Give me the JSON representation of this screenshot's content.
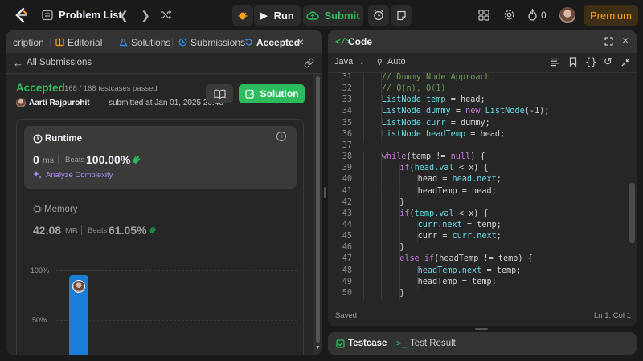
{
  "topbar": {
    "problem_list": "Problem List",
    "run": "Run",
    "submit": "Submit",
    "streak": "0",
    "premium": "Premium"
  },
  "left_tabs": {
    "description": "cription",
    "editorial": "Editorial",
    "solutions": "Solutions",
    "submissions": "Submissions",
    "accepted": "Accepted"
  },
  "submission": {
    "back_label": "All Submissions",
    "status": "Accepted",
    "testcases": "168 / 168 testcases passed",
    "author": "Aarti Rajpurohit",
    "submitted_at": "submitted at Jan 01, 2025 20:48",
    "solution_button": "Solution",
    "runtime": {
      "title": "Runtime",
      "value": "0",
      "unit": "ms",
      "beats_label": "Beats",
      "beats_value": "100.00%",
      "analyze": "Analyze Complexity"
    },
    "memory": {
      "title": "Memory",
      "value": "42.08",
      "unit": "MB",
      "beats_label": "Beats",
      "beats_value": "61.05%"
    },
    "chart": {
      "y_ticks": [
        "100%",
        "50%"
      ],
      "bar_fraction": 0.95
    }
  },
  "code_panel": {
    "title": "Code",
    "language": "Java",
    "mode": "Auto",
    "status": "Saved",
    "cursor": "Ln 1, Col 1",
    "lines": [
      {
        "n": "31",
        "indent": 2,
        "parts": [
          [
            "cm",
            "// Dummy Node Approach"
          ]
        ]
      },
      {
        "n": "32",
        "indent": 2,
        "parts": [
          [
            "cm",
            "// O(n), O(1)"
          ]
        ]
      },
      {
        "n": "33",
        "indent": 2,
        "parts": [
          [
            "ty",
            "ListNode"
          ],
          [
            "pl",
            " "
          ],
          [
            "ty",
            "temp"
          ],
          [
            "pl",
            " = head;"
          ]
        ]
      },
      {
        "n": "34",
        "indent": 2,
        "parts": [
          [
            "ty",
            "ListNode"
          ],
          [
            "pl",
            " "
          ],
          [
            "ty",
            "dummy"
          ],
          [
            "pl",
            " = "
          ],
          [
            "kw",
            "new"
          ],
          [
            "pl",
            " "
          ],
          [
            "ty",
            "ListNode"
          ],
          [
            "pl",
            "(-1);"
          ]
        ]
      },
      {
        "n": "35",
        "indent": 2,
        "parts": [
          [
            "ty",
            "ListNode"
          ],
          [
            "pl",
            " "
          ],
          [
            "ty",
            "curr"
          ],
          [
            "pl",
            " = dummy;"
          ]
        ]
      },
      {
        "n": "36",
        "indent": 2,
        "parts": [
          [
            "ty",
            "ListNode"
          ],
          [
            "pl",
            " "
          ],
          [
            "ty",
            "headTemp"
          ],
          [
            "pl",
            " = head;"
          ]
        ]
      },
      {
        "n": "37",
        "indent": 0,
        "parts": []
      },
      {
        "n": "38",
        "indent": 2,
        "parts": [
          [
            "kw",
            "while"
          ],
          [
            "pl",
            "(temp != "
          ],
          [
            "kw",
            "null"
          ],
          [
            "pl",
            ") {"
          ]
        ]
      },
      {
        "n": "39",
        "indent": 3,
        "parts": [
          [
            "kw",
            "if"
          ],
          [
            "pl",
            "("
          ],
          [
            "ty",
            "head.val"
          ],
          [
            "pl",
            " < x) {"
          ]
        ]
      },
      {
        "n": "40",
        "indent": 4,
        "parts": [
          [
            "pl",
            "head = "
          ],
          [
            "ty",
            "head.next"
          ],
          [
            "pl",
            ";"
          ]
        ]
      },
      {
        "n": "41",
        "indent": 4,
        "parts": [
          [
            "pl",
            "headTemp = head;"
          ]
        ]
      },
      {
        "n": "42",
        "indent": 3,
        "parts": [
          [
            "pl",
            "}"
          ]
        ]
      },
      {
        "n": "43",
        "indent": 3,
        "parts": [
          [
            "kw",
            "if"
          ],
          [
            "pl",
            "("
          ],
          [
            "ty",
            "temp.val"
          ],
          [
            "pl",
            " < x) {"
          ]
        ]
      },
      {
        "n": "44",
        "indent": 4,
        "parts": [
          [
            "ty",
            "curr.next"
          ],
          [
            "pl",
            " = temp;"
          ]
        ]
      },
      {
        "n": "45",
        "indent": 4,
        "parts": [
          [
            "pl",
            "curr = "
          ],
          [
            "ty",
            "curr.next"
          ],
          [
            "pl",
            ";"
          ]
        ]
      },
      {
        "n": "46",
        "indent": 3,
        "parts": [
          [
            "pl",
            "}"
          ]
        ]
      },
      {
        "n": "47",
        "indent": 3,
        "parts": [
          [
            "kw",
            "else if"
          ],
          [
            "pl",
            "(headTemp != temp) {"
          ]
        ]
      },
      {
        "n": "48",
        "indent": 4,
        "parts": [
          [
            "ty",
            "headTemp.next"
          ],
          [
            "pl",
            " = temp;"
          ]
        ]
      },
      {
        "n": "49",
        "indent": 4,
        "parts": [
          [
            "pl",
            "headTemp = temp;"
          ]
        ]
      },
      {
        "n": "50",
        "indent": 3,
        "parts": [
          [
            "pl",
            "}"
          ]
        ]
      }
    ]
  },
  "bottom_panel": {
    "testcase": "Testcase",
    "test_result": "Test Result"
  },
  "colors": {
    "accent_green": "#2cbb5d",
    "accent_orange": "#ffa116",
    "accent_blue": "#3c8ee8",
    "chart_bar": "#1a7dd8"
  }
}
